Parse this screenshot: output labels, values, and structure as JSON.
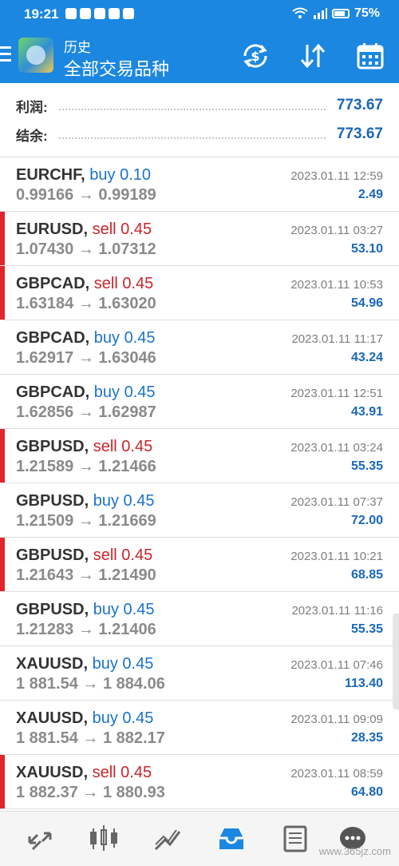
{
  "status_bar": {
    "time": "19:21",
    "battery": "75%"
  },
  "header": {
    "subtitle": "历史",
    "title": "全部交易品种"
  },
  "summary": {
    "profit_label": "利润:",
    "profit_value": "773.67",
    "balance_label": "结余:",
    "balance_value": "773.67"
  },
  "trades": [
    {
      "symbol": "EURCHF",
      "type": "buy",
      "volume": "0.10",
      "open": "0.99166",
      "close": "0.99189",
      "time": "2023.01.11 12:59",
      "profit": "2.49"
    },
    {
      "symbol": "EURUSD",
      "type": "sell",
      "volume": "0.45",
      "open": "1.07430",
      "close": "1.07312",
      "time": "2023.01.11 03:27",
      "profit": "53.10"
    },
    {
      "symbol": "GBPCAD",
      "type": "sell",
      "volume": "0.45",
      "open": "1.63184",
      "close": "1.63020",
      "time": "2023.01.11 10:53",
      "profit": "54.96"
    },
    {
      "symbol": "GBPCAD",
      "type": "buy",
      "volume": "0.45",
      "open": "1.62917",
      "close": "1.63046",
      "time": "2023.01.11 11:17",
      "profit": "43.24"
    },
    {
      "symbol": "GBPCAD",
      "type": "buy",
      "volume": "0.45",
      "open": "1.62856",
      "close": "1.62987",
      "time": "2023.01.11 12:51",
      "profit": "43.91"
    },
    {
      "symbol": "GBPUSD",
      "type": "sell",
      "volume": "0.45",
      "open": "1.21589",
      "close": "1.21466",
      "time": "2023.01.11 03:24",
      "profit": "55.35"
    },
    {
      "symbol": "GBPUSD",
      "type": "buy",
      "volume": "0.45",
      "open": "1.21509",
      "close": "1.21669",
      "time": "2023.01.11 07:37",
      "profit": "72.00"
    },
    {
      "symbol": "GBPUSD",
      "type": "sell",
      "volume": "0.45",
      "open": "1.21643",
      "close": "1.21490",
      "time": "2023.01.11 10:21",
      "profit": "68.85"
    },
    {
      "symbol": "GBPUSD",
      "type": "buy",
      "volume": "0.45",
      "open": "1.21283",
      "close": "1.21406",
      "time": "2023.01.11 11:16",
      "profit": "55.35"
    },
    {
      "symbol": "XAUUSD",
      "type": "buy",
      "volume": "0.45",
      "open": "1 881.54",
      "close": "1 884.06",
      "time": "2023.01.11 07:46",
      "profit": "113.40"
    },
    {
      "symbol": "XAUUSD",
      "type": "buy",
      "volume": "0.45",
      "open": "1 881.54",
      "close": "1 882.17",
      "time": "2023.01.11 09:09",
      "profit": "28.35"
    },
    {
      "symbol": "XAUUSD",
      "type": "sell",
      "volume": "0.45",
      "open": "1 882.37",
      "close": "1 880.93",
      "time": "2023.01.11 08:59",
      "profit": "64.80"
    }
  ],
  "arrow": "→",
  "watermark": "www.365jz.com",
  "colors": {
    "brand": "#1b87e0",
    "buy": "#1a73c9",
    "sell": "#c9252a",
    "profit": "#1a67b8"
  },
  "icons": {
    "toolbar": [
      "currency-exchange-icon",
      "sort-icon",
      "calendar-icon"
    ],
    "bottom_nav": [
      "quotes-icon",
      "chart-icon",
      "trade-icon",
      "history-icon",
      "news-icon",
      "chat-icon"
    ]
  }
}
